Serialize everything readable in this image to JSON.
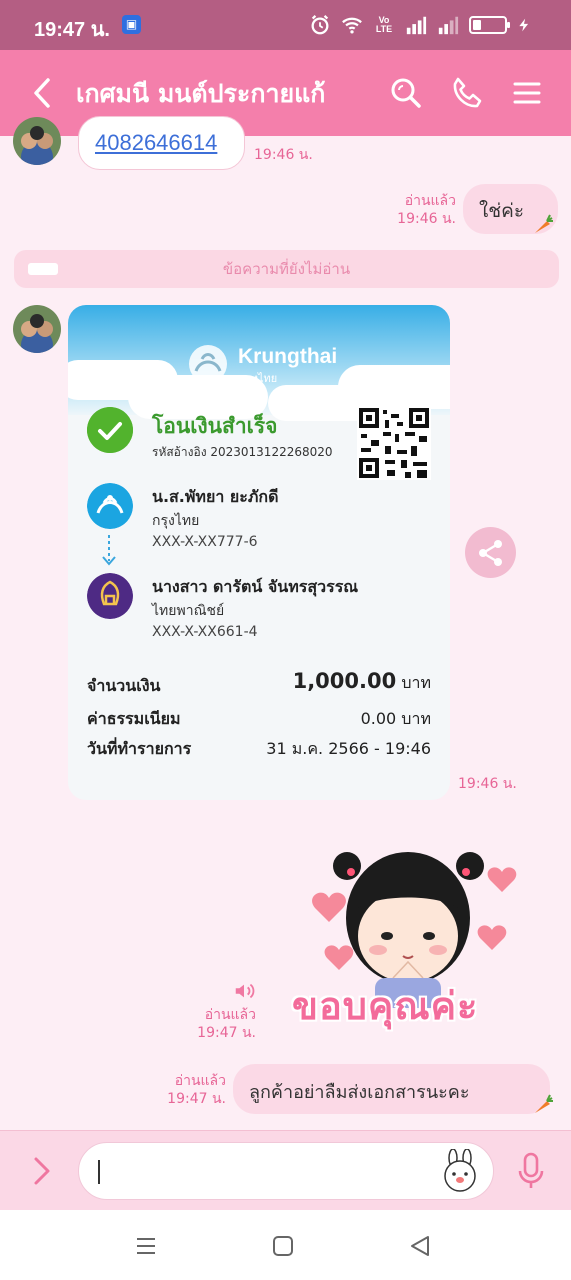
{
  "status_bar": {
    "time": "19:47 น.",
    "volte": "Vo LTE"
  },
  "header": {
    "title": "เกศมนี มนต์ประกายแก้"
  },
  "messages": {
    "incoming_number": {
      "text": "4082646614",
      "time": "19:46 น."
    },
    "reply_yes": {
      "read": "อ่านแล้ว",
      "time": "19:46 น.",
      "text": "ใช่ค่ะ"
    },
    "unread_divider": "ข้อความที่ยังไม่อ่าน",
    "slip_time": "19:46 น.",
    "sticker_meta": {
      "read": "อ่านแล้ว",
      "time": "19:47 น."
    },
    "last_out": {
      "read": "อ่านแล้ว",
      "time": "19:47 น.",
      "text": "ลูกค้าอย่าลืมส่งเอกสารนะคะ"
    }
  },
  "slip": {
    "brand_en": "Krungthai",
    "brand_th": "กรุงไทย",
    "status": "โอนเงินสำเร็จ",
    "reference": "รหัสอ้างอิง 2023013122268020",
    "sender": {
      "name": "น.ส.พัทยา ยะภักดี",
      "bank": "กรุงไทย",
      "account": "XXX-X-XX777-6"
    },
    "receiver": {
      "name": "นางสาว ดารัตน์ จันทรสุวรรณ",
      "bank": "ไทยพาณิชย์",
      "account": "XXX-X-XX661-4"
    },
    "amount_label": "จำนวนเงิน",
    "amount_value": "1,000.00",
    "amount_unit": "บาท",
    "fee_label": "ค่าธรรมเนียม",
    "fee_value": "0.00 บาท",
    "date_label": "วันที่ทำรายการ",
    "date_value": "31 ม.ค. 2566 - 19:46"
  },
  "sticker_text": "ขอบคุณค่ะ",
  "colors": {
    "header": "#f47fab",
    "status_bar": "#b45e83",
    "accent": "#e76596",
    "background": "#fdeef5"
  }
}
